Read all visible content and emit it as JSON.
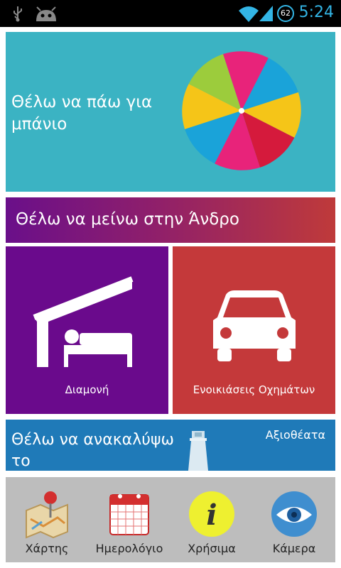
{
  "status_bar": {
    "time": "5:24",
    "battery_level": "62",
    "icons": [
      "usb-icon",
      "android-icon",
      "wifi-icon",
      "signal-icon",
      "battery-icon"
    ]
  },
  "tiles": {
    "beach": {
      "label": "Θέλω να πάω για μπάνιο",
      "color": "#3bb3c3"
    },
    "stay": {
      "label": "Θέλω να μείνω στην Άνδρο",
      "color": "#8f1f6b"
    },
    "accommodation": {
      "label": "Διαμονή",
      "color": "#6a0a8c"
    },
    "rentals": {
      "label": "Ενοικιάσεις Οχημάτων",
      "color": "#c4393a"
    },
    "discover": {
      "label": "Θέλω να ανακαλύψω το",
      "sights": "Αξιοθέατα",
      "color": "#1f7ab8"
    }
  },
  "bottom_nav": {
    "items": [
      {
        "label": "Χάρτης",
        "icon": "map-icon"
      },
      {
        "label": "Ημερολόγιο",
        "icon": "calendar-icon"
      },
      {
        "label": "Χρήσιμα",
        "icon": "info-icon"
      },
      {
        "label": "Κάμερα",
        "icon": "eye-icon"
      }
    ]
  }
}
